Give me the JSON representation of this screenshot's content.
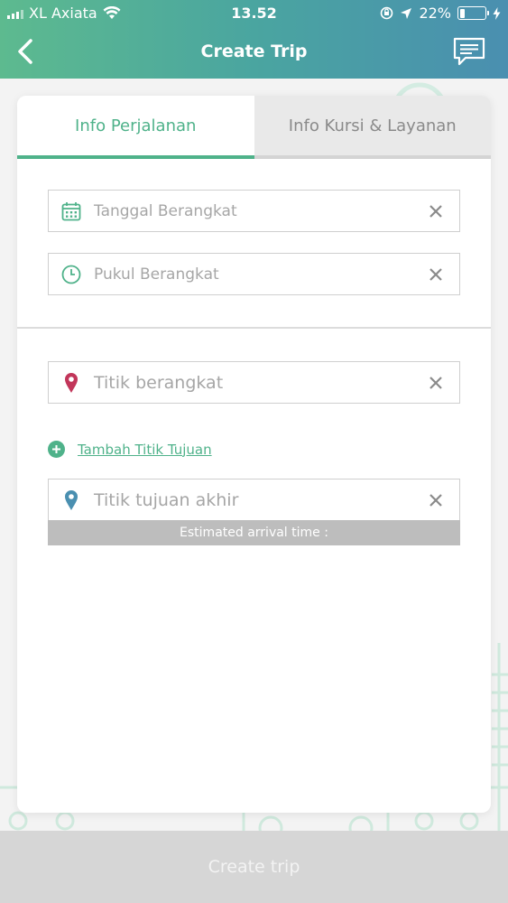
{
  "status_bar": {
    "carrier": "XL Axiata",
    "time": "13.52",
    "battery_percent": "22%",
    "battery_level": 0.22
  },
  "nav": {
    "title": "Create Trip",
    "back_icon": "chevron-left-icon",
    "chat_icon": "chat-bubble-icon"
  },
  "tabs": [
    {
      "label": "Info Perjalanan",
      "active": true
    },
    {
      "label": "Info Kursi & Layanan",
      "active": false
    }
  ],
  "fields": {
    "departure_date": {
      "placeholder": "Tanggal Berangkat",
      "icon": "calendar-icon"
    },
    "departure_time": {
      "placeholder": "Pukul Berangkat",
      "icon": "clock-icon"
    },
    "origin": {
      "placeholder": "Titik berangkat",
      "icon": "pin-red-icon"
    },
    "destination": {
      "placeholder": "Titik tujuan akhir",
      "icon": "pin-blue-icon"
    }
  },
  "add_destination_label": "Tambah Titik Tujuan",
  "eta_label": "Estimated arrival time :",
  "create_button_label": "Create trip",
  "colors": {
    "accent": "#4fb28a",
    "header_start": "#5dba8f",
    "header_end": "#4a8fb0",
    "pin_red": "#c2365a",
    "pin_blue": "#4a8fb0"
  }
}
